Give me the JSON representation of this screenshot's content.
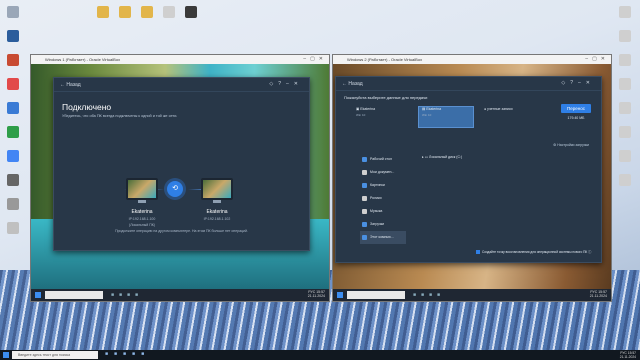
{
  "desktop": {
    "icons_left": [
      {
        "name": "recycle-bin-icon",
        "color": "#9aa7b8"
      },
      {
        "name": "cpu-app-icon",
        "color": "#2b5d9c"
      },
      {
        "name": "app-icon",
        "color": "#c84b32"
      },
      {
        "name": "app-icon",
        "color": "#e24a4a"
      },
      {
        "name": "app-icon",
        "color": "#3a7bd5"
      },
      {
        "name": "app-icon",
        "color": "#2e9e49"
      },
      {
        "name": "app-icon",
        "color": "#4285f4"
      },
      {
        "name": "app-icon",
        "color": "#666666"
      },
      {
        "name": "app-icon",
        "color": "#999999"
      },
      {
        "name": "app-icon",
        "color": "#c0c0c0"
      }
    ],
    "icons_top": [
      {
        "name": "folder-icon",
        "color": "#e2b54a"
      },
      {
        "name": "folder-icon",
        "color": "#e2b54a"
      },
      {
        "name": "folder-icon",
        "color": "#e2b54a"
      },
      {
        "name": "file-icon",
        "color": "#cfcfcf"
      },
      {
        "name": "app-icon",
        "color": "#3a3a3a"
      }
    ],
    "icons_right": [
      {
        "name": "file-icon",
        "color": "#cfcfcf"
      },
      {
        "name": "file-icon",
        "color": "#cfcfcf"
      },
      {
        "name": "file-icon",
        "color": "#cfcfcf"
      },
      {
        "name": "file-icon",
        "color": "#cfcfcf"
      },
      {
        "name": "file-icon",
        "color": "#cfcfcf"
      },
      {
        "name": "file-icon",
        "color": "#cfcfcf"
      },
      {
        "name": "file-icon",
        "color": "#cfcfcf"
      },
      {
        "name": "file-icon",
        "color": "#cfcfcf"
      }
    ]
  },
  "vm_left": {
    "title": "Windows 1 (Работает) - Oracle VirtualBox",
    "taskbar_clock": "15:57\n21.11.2024",
    "taskbar_lang": "РУС"
  },
  "vm_right": {
    "title": "Windows 2 (Работает) - Oracle VirtualBox",
    "taskbar_clock": "15:57\n21.11.2024",
    "taskbar_lang": "РУС"
  },
  "left_app": {
    "back_label": "Назад",
    "title": "Подключено",
    "subtitle": "Убедитесь, что оба ПК всегда подключены к одной и той же сети.",
    "pc_left": {
      "name": "Ekaterina",
      "ip": "IP:192.168.1.100",
      "tag": "(Локальный ПК)"
    },
    "pc_right": {
      "name": "Ekaterina",
      "ip": "IP:192.168.1.102",
      "tag": ""
    },
    "footnote": "Продолжите операцию на другом компьютере. На этом ПК больше нет операций."
  },
  "right_app": {
    "back_label": "Назад",
    "title": "Пожалуйста выберите данные для передачи",
    "source_pc": {
      "name": "Ekaterina",
      "sub": "Win 10"
    },
    "target_pc": {
      "name": "Ekaterina",
      "sub": "Win 10"
    },
    "account_label": "учетные записи",
    "transfer_button": "Перенос",
    "transfer_size": "179.40 МБ",
    "settings_link": "Настройки загрузки",
    "sidebar": [
      {
        "label": "Рабочий стол",
        "icon": "desktop-icon",
        "color": "#4a90e2"
      },
      {
        "label": "Мои докумен...",
        "icon": "documents-icon",
        "color": "#cfcfcf"
      },
      {
        "label": "Картинки",
        "icon": "pictures-icon",
        "color": "#4a90e2"
      },
      {
        "label": "Ролики",
        "icon": "videos-icon",
        "color": "#cfcfcf"
      },
      {
        "label": "Музыка",
        "icon": "music-icon",
        "color": "#cfcfcf"
      },
      {
        "label": "Загрузки",
        "icon": "downloads-icon",
        "color": "#4a90e2"
      },
      {
        "label": "Этот компью...",
        "icon": "computer-icon",
        "color": "#4a90e2"
      }
    ],
    "drive_label": "Локальный диск (C:)",
    "restore_text": "Создайте точку восстановления для операционной системы нового ПК"
  },
  "host_taskbar": {
    "search_placeholder": "Введите здесь текст для поиска",
    "clock": "15:57\n21.11.2024",
    "lang": "РУС"
  }
}
